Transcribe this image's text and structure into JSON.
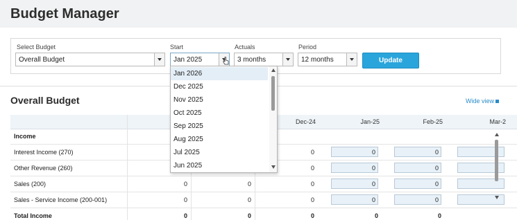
{
  "app": {
    "title": "Budget Manager"
  },
  "filters": {
    "select_budget": {
      "label": "Select Budget",
      "value": "Overall Budget"
    },
    "start": {
      "label": "Start",
      "value": "Jan 2025"
    },
    "actuals": {
      "label": "Actuals",
      "value": "3 months"
    },
    "period": {
      "label": "Period",
      "value": "12 months"
    },
    "update_label": "Update"
  },
  "dropdown": {
    "items": [
      "Jan 2026",
      "Dec 2025",
      "Nov 2025",
      "Oct 2025",
      "Sep 2025",
      "Aug 2025",
      "Jul 2025",
      "Jun 2025"
    ],
    "selected": "Jan 2026"
  },
  "section": {
    "title": "Overall Budget",
    "wide_view": "Wide view"
  },
  "table": {
    "columns": [
      "Dec-24",
      "Jan-25",
      "Feb-25",
      "Mar-2"
    ],
    "rows": [
      {
        "label": "Income",
        "values": [
          "",
          "",
          "",
          "",
          "",
          ""
        ]
      },
      {
        "label": "Interest Income (270)",
        "values": [
          "",
          "",
          "0",
          "0",
          "0",
          ""
        ]
      },
      {
        "label": "Other Revenue (260)",
        "values": [
          "",
          "",
          "0",
          "0",
          "0",
          ""
        ]
      },
      {
        "label": "Sales (200)",
        "values": [
          "0",
          "0",
          "0",
          "0",
          "0",
          ""
        ]
      },
      {
        "label": "Sales - Service Income (200-001)",
        "values": [
          "0",
          "0",
          "0",
          "0",
          "0",
          ""
        ]
      },
      {
        "label": "Total Income",
        "values": [
          "0",
          "0",
          "0",
          "0",
          "0",
          ""
        ]
      }
    ]
  }
}
